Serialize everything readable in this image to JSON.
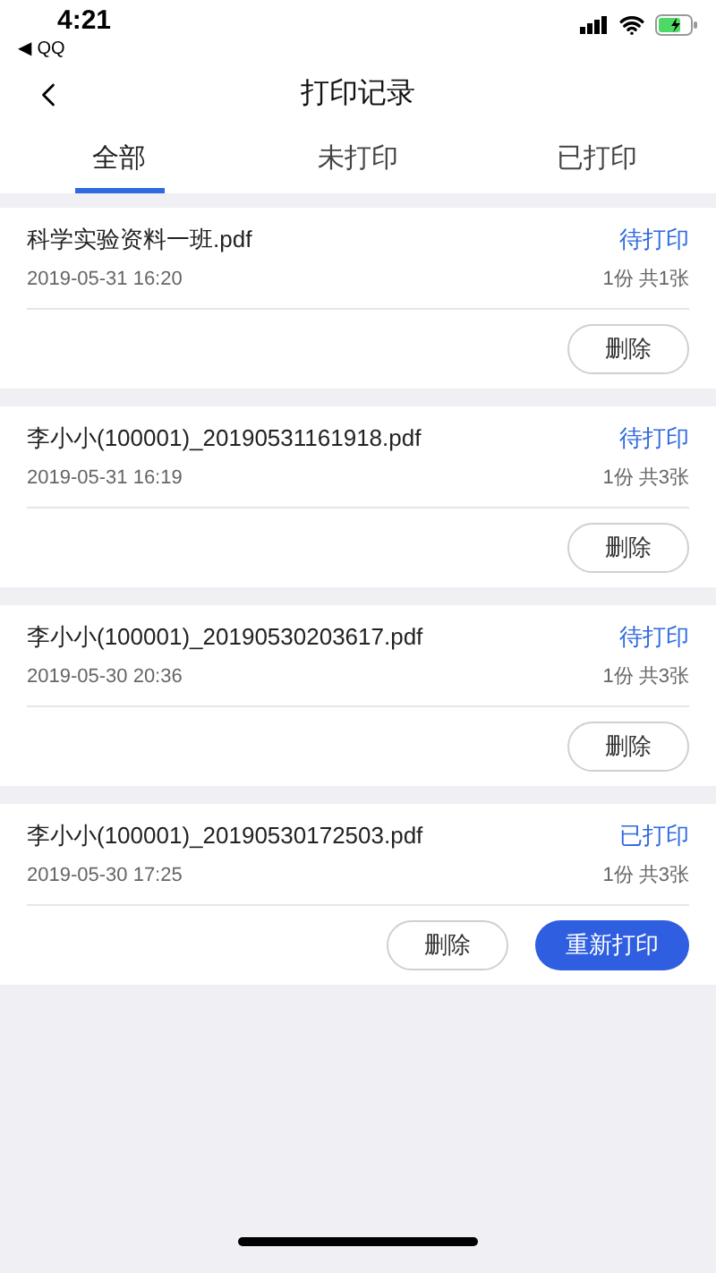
{
  "status_bar": {
    "time": "4:21",
    "back_app": "◀ QQ"
  },
  "header": {
    "title": "打印记录"
  },
  "tabs": [
    {
      "label": "全部",
      "selected": true
    },
    {
      "label": "未打印",
      "selected": false
    },
    {
      "label": "已打印",
      "selected": false
    }
  ],
  "records": [
    {
      "file": "科学实验资料一班.pdf",
      "status": "待打印",
      "date": "2019-05-31 16:20",
      "count": "1份 共1张",
      "buttons": [
        {
          "kind": "outline",
          "label": "删除"
        }
      ]
    },
    {
      "file": "李小小(100001)_20190531161918.pdf",
      "status": "待打印",
      "date": "2019-05-31 16:19",
      "count": "1份 共3张",
      "buttons": [
        {
          "kind": "outline",
          "label": "删除"
        }
      ]
    },
    {
      "file": "李小小(100001)_20190530203617.pdf",
      "status": "待打印",
      "date": "2019-05-30 20:36",
      "count": "1份 共3张",
      "buttons": [
        {
          "kind": "outline",
          "label": "删除"
        }
      ]
    },
    {
      "file": "李小小(100001)_20190530172503.pdf",
      "status": "已打印",
      "date": "2019-05-30 17:25",
      "count": "1份 共3张",
      "buttons": [
        {
          "kind": "outline",
          "label": "删除"
        },
        {
          "kind": "primary",
          "label": "重新打印"
        }
      ]
    }
  ]
}
